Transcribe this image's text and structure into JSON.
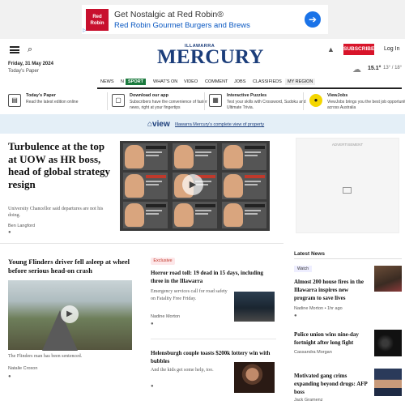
{
  "ad": {
    "logo": "Red Robin",
    "headline": "Get Nostalgic at Red Robin®",
    "sub": "Red Robin Gourmet Burgers and Brews",
    "arrow": "➔",
    "info": "▷"
  },
  "header": {
    "menu_icon": "menu-icon",
    "search_icon": "⌕",
    "brand_top": "ILLAWARRA",
    "brand": "MERCURY",
    "subscribe": "SUBSCRIBE",
    "login": "Log In",
    "date": "Friday, 31 May 2024",
    "todays_paper": "Today's Paper",
    "weather": {
      "icon": "☁",
      "temp": "15.1°",
      "range": "13° / 18°"
    }
  },
  "nav": {
    "items": [
      "NEWS",
      "N",
      "SPORT",
      "WHAT'S ON",
      "VIDEO",
      "COMMENT",
      "JOBS",
      "CLASSIFIEDS",
      "MY REGION"
    ]
  },
  "promos": [
    {
      "icon": "▤",
      "title": "Today's Paper",
      "desc": "Read the latest edition online"
    },
    {
      "icon": "▢",
      "title": "Download our app",
      "desc": "Subscribers have the convenience of faster news, right at your fingertips"
    },
    {
      "icon": "▦",
      "title": "Interactive Puzzles",
      "desc": "Test your skills with Crossword, Sudoku and Ultimate Trivia."
    },
    {
      "icon": "●",
      "title": "ViewJobs",
      "desc": "ViewJobs brings you the best job opportunities across Australia"
    }
  ],
  "view_band": {
    "logo": "⌂view",
    "text": "Illawarra Mercury's complete view of property"
  },
  "lead": {
    "headline": "Turbulence at the top at UOW as HR boss, head of global strategy resign",
    "summary": "University Chancellor said departures are not his doing.",
    "author": "Ben Langford",
    "comment_icon": "●"
  },
  "right_ad": {
    "label": "ADVERTISEMENT",
    "icon": "▣"
  },
  "story2": {
    "headline": "Young Flinders driver fell asleep at wheel before serious head-on crash",
    "summary": "The Flinders man has been sentenced.",
    "author": "Natalie Croxon"
  },
  "story3": {
    "badge": "Exclusive",
    "headline": "Horror road toll: 19 dead in 15 days, including three in the Illawarra",
    "summary": "Emergency services call for road safety on Fatality Free Friday.",
    "author": "Nadine Morton"
  },
  "story4": {
    "headline": "Helensburgh couple toasts $200k lottery win with bubbles",
    "summary": "And the kids get some help, too."
  },
  "latest": {
    "title": "Latest News",
    "items": [
      {
        "tag": "Watch",
        "headline": "Almost 200 house fires in the Illawarra inspires new program to save lives",
        "author": "Nadine Morton • 1hr ago"
      },
      {
        "headline": "Police union wins nine-day fortnight after long fight",
        "author": "Cassandra Morgan"
      },
      {
        "headline": "Motivated gang crims expanding beyond drugs: AFP boss",
        "author": "Jack Gramenz"
      }
    ]
  }
}
